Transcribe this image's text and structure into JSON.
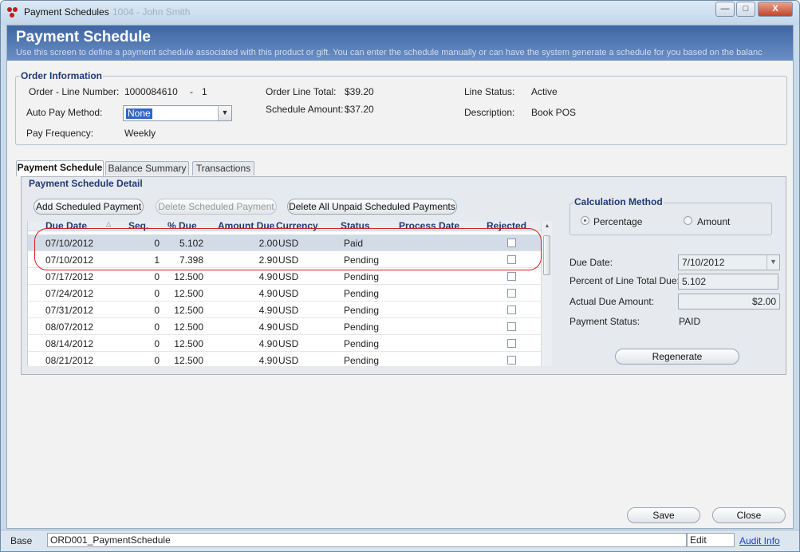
{
  "window": {
    "title": "Payment Schedules",
    "title_suffix": "1004 - John Smith",
    "controls": {
      "minimize": "—",
      "maximize": "□",
      "close": "X"
    }
  },
  "header": {
    "title": "Payment Schedule",
    "description": "Use this screen to define a payment schedule associated with this product or gift. You can enter the schedule manually or can have the system generate a schedule for you based on the balanc"
  },
  "order_info": {
    "group_title": "Order Information",
    "order_line_label": "Order - Line Number:",
    "order_number": "1000084610",
    "line_separator": "-",
    "line_number": "1",
    "order_line_total_label": "Order Line Total:",
    "order_line_total": "$39.20",
    "line_status_label": "Line Status:",
    "line_status": "Active",
    "auto_pay_label": "Auto Pay Method:",
    "auto_pay_value": "None",
    "schedule_amount_label": "Schedule Amount:",
    "schedule_amount": "$37.20",
    "description_label": "Description:",
    "description": "Book POS",
    "pay_frequency_label": "Pay Frequency:",
    "pay_frequency": "Weekly"
  },
  "tabs": [
    {
      "label": "Payment Schedule",
      "active": true
    },
    {
      "label": "Balance Summary",
      "active": false
    },
    {
      "label": "Transactions",
      "active": false
    }
  ],
  "detail": {
    "group_title": "Payment Schedule Detail",
    "add_button": "Add Scheduled Payment",
    "delete_button": "Delete Scheduled Payment",
    "delete_all_button": "Delete All Unpaid Scheduled Payments",
    "columns": {
      "due_date": "Due Date",
      "seq": "Seq.",
      "pct_due": "% Due",
      "amount_due": "Amount Due",
      "currency": "Currency",
      "status": "Status",
      "process_date": "Process Date",
      "rejected": "Rejected"
    },
    "rows": [
      {
        "due_date": "07/10/2012",
        "seq": "0",
        "pct_due": "5.102",
        "amount_due": "2.00",
        "currency": "USD",
        "status": "Paid",
        "process_date": "",
        "rejected": false
      },
      {
        "due_date": "07/10/2012",
        "seq": "1",
        "pct_due": "7.398",
        "amount_due": "2.90",
        "currency": "USD",
        "status": "Pending",
        "process_date": "",
        "rejected": false
      },
      {
        "due_date": "07/17/2012",
        "seq": "0",
        "pct_due": "12.500",
        "amount_due": "4.90",
        "currency": "USD",
        "status": "Pending",
        "process_date": "",
        "rejected": false
      },
      {
        "due_date": "07/24/2012",
        "seq": "0",
        "pct_due": "12.500",
        "amount_due": "4.90",
        "currency": "USD",
        "status": "Pending",
        "process_date": "",
        "rejected": false
      },
      {
        "due_date": "07/31/2012",
        "seq": "0",
        "pct_due": "12.500",
        "amount_due": "4.90",
        "currency": "USD",
        "status": "Pending",
        "process_date": "",
        "rejected": false
      },
      {
        "due_date": "08/07/2012",
        "seq": "0",
        "pct_due": "12.500",
        "amount_due": "4.90",
        "currency": "USD",
        "status": "Pending",
        "process_date": "",
        "rejected": false
      },
      {
        "due_date": "08/14/2012",
        "seq": "0",
        "pct_due": "12.500",
        "amount_due": "4.90",
        "currency": "USD",
        "status": "Pending",
        "process_date": "",
        "rejected": false
      },
      {
        "due_date": "08/21/2012",
        "seq": "0",
        "pct_due": "12.500",
        "amount_due": "4.90",
        "currency": "USD",
        "status": "Pending",
        "process_date": "",
        "rejected": false
      }
    ]
  },
  "calc": {
    "group_title": "Calculation Method",
    "percentage_label": "Percentage",
    "amount_label": "Amount",
    "selected": "percentage",
    "due_date_label": "Due Date:",
    "due_date_value": "7/10/2012",
    "percent_label": "Percent of Line Total Due:",
    "percent_value": "5.102",
    "actual_label": "Actual Due Amount:",
    "actual_value": "$2.00",
    "status_label": "Payment Status:",
    "status_value": "PAID",
    "regenerate_button": "Regenerate"
  },
  "footer": {
    "save_button": "Save",
    "close_button": "Close"
  },
  "statusbar": {
    "base": "Base",
    "form_id": "ORD001_PaymentSchedule",
    "mode": "Edit",
    "audit_link": "Audit Info"
  },
  "colors": {
    "header_blue": "#3e66a3",
    "group_title_blue": "#1f3a78",
    "highlight_red": "#d42020",
    "link_blue": "#1a3fb8"
  }
}
